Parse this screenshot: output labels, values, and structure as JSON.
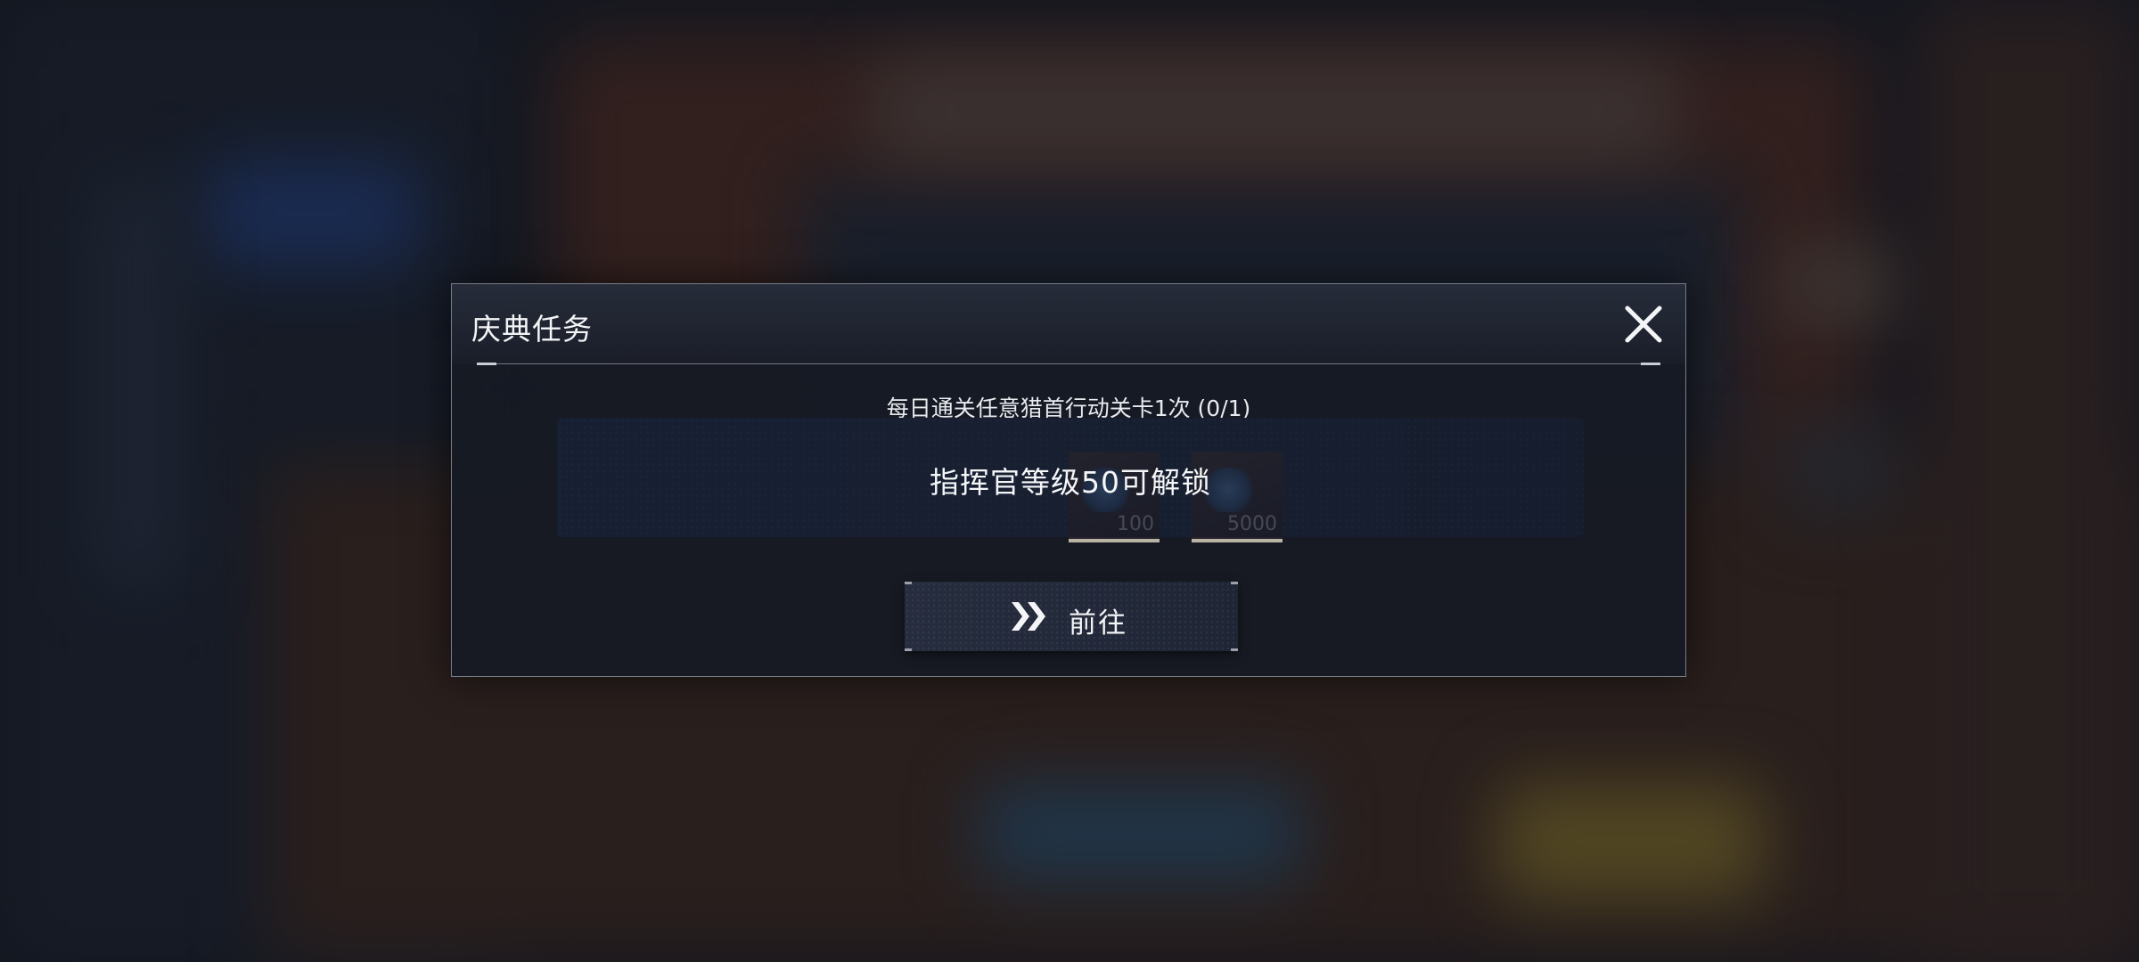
{
  "dialog": {
    "title": "庆典任务",
    "task_description": "每日通关任意猎首行动关卡1次 (0/1)",
    "lock_message": "指挥官等级50可解锁",
    "rewards": [
      {
        "icon": "blue-crystal-icon",
        "count": "100"
      },
      {
        "icon": "coin-stack-icon",
        "count": "5000"
      }
    ],
    "go_button_label": "前往"
  },
  "colors": {
    "dialog_bg": "#161a24",
    "text": "#f3f4f6",
    "reward_panel": "#22304a",
    "button_bg": "#262d3e"
  }
}
